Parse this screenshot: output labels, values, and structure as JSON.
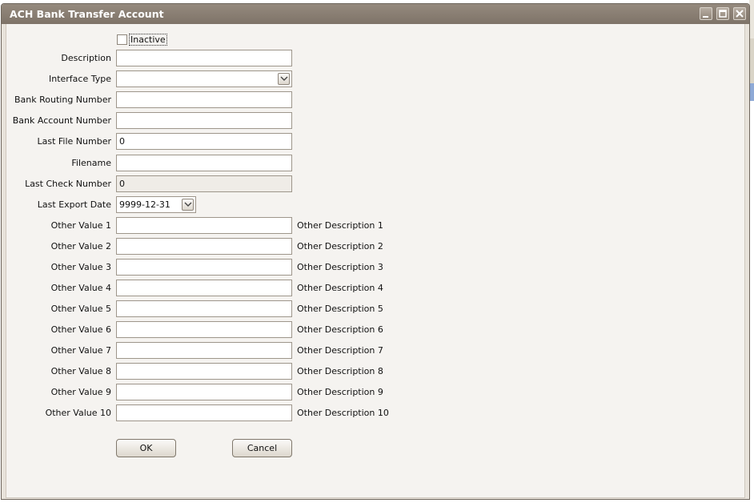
{
  "window": {
    "title": "ACH Bank Transfer Account",
    "controls": [
      "minimize-icon",
      "maximize-icon",
      "close-icon"
    ]
  },
  "form": {
    "inactive": {
      "label": "Inactive",
      "checked": false
    },
    "description": {
      "label": "Description",
      "value": ""
    },
    "interface_type": {
      "label": "Interface Type",
      "value": ""
    },
    "bank_routing_number": {
      "label": "Bank Routing Number",
      "value": ""
    },
    "bank_account_number": {
      "label": "Bank Account Number",
      "value": ""
    },
    "last_file_number": {
      "label": "Last File Number",
      "value": "0"
    },
    "filename": {
      "label": "Filename",
      "value": ""
    },
    "last_check_number": {
      "label": "Last Check Number",
      "value": "0"
    },
    "last_export_date": {
      "label": "Last Export Date",
      "value": "9999-12-31"
    },
    "other": [
      {
        "label": "Other Value 1",
        "value": "",
        "description": "Other Description 1"
      },
      {
        "label": "Other Value 2",
        "value": "",
        "description": "Other Description 2"
      },
      {
        "label": "Other Value 3",
        "value": "",
        "description": "Other Description 3"
      },
      {
        "label": "Other Value 4",
        "value": "",
        "description": "Other Description 4"
      },
      {
        "label": "Other Value 5",
        "value": "",
        "description": "Other Description 5"
      },
      {
        "label": "Other Value 6",
        "value": "",
        "description": "Other Description 6"
      },
      {
        "label": "Other Value 7",
        "value": "",
        "description": "Other Description 7"
      },
      {
        "label": "Other Value 8",
        "value": "",
        "description": "Other Description 8"
      },
      {
        "label": "Other Value 9",
        "value": "",
        "description": "Other Description 9"
      },
      {
        "label": "Other Value 10",
        "value": "",
        "description": "Other Description 10"
      }
    ]
  },
  "buttons": {
    "ok": "OK",
    "cancel": "Cancel"
  }
}
